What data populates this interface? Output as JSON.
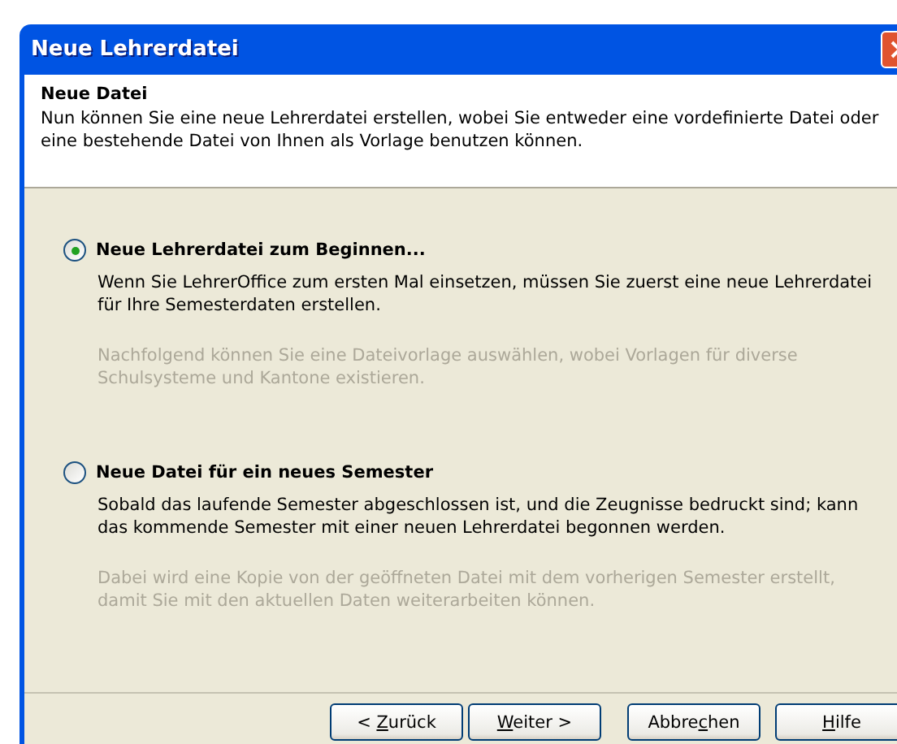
{
  "window": {
    "title": "Neue Lehrerdatei"
  },
  "header": {
    "title": "Neue Datei",
    "description": "Nun können Sie eine neue Lehrerdatei erstellen, wobei Sie entweder eine vordefinierte Datei oder eine bestehende Datei von Ihnen als Vorlage benutzen können."
  },
  "options": [
    {
      "label": "Neue Lehrerdatei zum Beginnen...",
      "selected": true,
      "description": "Wenn Sie LehrerOffice zum ersten Mal einsetzen, müssen Sie zuerst eine neue Lehrerdatei für Ihre Semesterdaten erstellen.",
      "note": "Nachfolgend können Sie eine Dateivorlage auswählen, wobei Vorlagen für diverse Schulsysteme und Kantone existieren."
    },
    {
      "label": "Neue Datei für ein neues Semester",
      "selected": false,
      "description": "Sobald das laufende Semester abgeschlossen ist, und die Zeugnisse bedruckt sind; kann das kommende Semester mit einer neuen Lehrerdatei begonnen werden.",
      "note": "Dabei wird eine Kopie von der geöffneten Datei mit dem vorherigen Semester erstellt, damit Sie mit den aktuellen Daten weiterarbeiten können."
    }
  ],
  "buttons": [
    {
      "before": "< ",
      "key": "Z",
      "after": "urück"
    },
    {
      "key": "W",
      "after": "eiter >"
    },
    {
      "before": "Abbre",
      "key": "c",
      "after": "hen"
    },
    {
      "key": "H",
      "after": "ilfe"
    }
  ]
}
